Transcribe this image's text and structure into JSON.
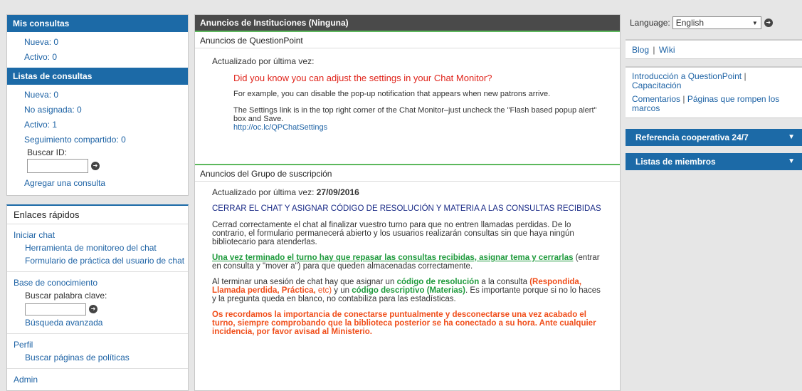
{
  "left": {
    "mis_title": "Mis consultas",
    "mis": [
      {
        "label": "Nueva: 0"
      },
      {
        "label": "Activo: 0"
      }
    ],
    "listas_title": "Listas de consultas",
    "listas": [
      {
        "label": "Nueva: 0"
      },
      {
        "label": "No asignada: 0"
      },
      {
        "label": "Activo: 1"
      },
      {
        "label": "Seguimiento compartido: 0"
      }
    ],
    "buscar_id": "Buscar ID:",
    "agregar": "Agregar una consulta",
    "enlaces_title": "Enlaces rápidos",
    "iniciar_chat": "Iniciar chat",
    "herramienta": "Herramienta de monitoreo del chat",
    "formulario": "Formulario de práctica del usuario de chat",
    "base": "Base de conocimiento",
    "buscar_palabra": "Buscar palabra clave:",
    "busqueda_avanzada": "Búsqueda avanzada",
    "perfil": "Perfil",
    "politicas": "Buscar páginas de políticas",
    "admin": "Admin"
  },
  "mid": {
    "title": "Anuncios de Instituciones (Ninguna)",
    "qp": {
      "title": "Anuncios de QuestionPoint",
      "updated": "Actualizado por última vez:",
      "headline": "Did you know you can adjust the settings in your Chat Monitor?",
      "p1": "For example, you can disable the pop-up notification that appears when new patrons arrive.",
      "p2": "The Settings link is in the top right corner of the Chat Monitor–just uncheck the \"Flash based popup alert\" box and Save.",
      "link": "http://oc.lc/QPChatSettings"
    },
    "grp": {
      "title": "Anuncios del Grupo de suscripción",
      "updated_label": "Actualizado por última vez:",
      "updated_date": "27/09/2016",
      "headline": "CERRAR EL CHAT Y ASIGNAR CÓDIGO DE RESOLUCIÓN Y MATERIA A LAS CONSULTAS RECIBIDAS",
      "p1": "Cerrad correctamente el chat al finalizar vuestro turno para que no entren llamadas perdidas. De lo contrario, el formulario permanecerá abierto y los usuarios realizarán consultas sin que haya ningún bibliotecario para atenderlas.",
      "p2_green": "Una vez terminado el turno hay que repasar las consultas recibidas, asignar tema y cerrarlas",
      "p2_rest": " (entrar en consulta y \"mover a\") para que queden almacenadas correctamente.",
      "p3_a": "Al terminar una sesión de chat hay que asignar un ",
      "p3_b": "código de resolución",
      "p3_c": " a la consulta ",
      "p3_d": "(Respondida, Llamada perdida, Práctica,",
      "p3_e": " etc)",
      "p3_f": " y un ",
      "p3_g": "código descriptivo",
      "p3_h": " (Materias)",
      "p3_i": ". Es importante porque si no lo haces y la pregunta queda en blanco, no contabiliza para las estadísticas.",
      "p4": "Os recordamos la importancia de conectarse puntualmente y desconectarse una vez acabado el turno, siempre comprobando que la biblioteca posterior se ha conectado a su hora. Ante cualquier incidencia, por favor avisad al Ministerio."
    }
  },
  "right": {
    "language_label": "Language:",
    "language_value": "English",
    "blog": "Blog",
    "wiki": "Wiki",
    "intro": "Introducción a QuestionPoint",
    "capacitacion": "Capacitación",
    "comentarios": "Comentarios",
    "paginas": "Páginas que rompen los marcos",
    "sep": "|",
    "referencia": "Referencia cooperativa 24/7",
    "listas": "Listas de miembros"
  }
}
